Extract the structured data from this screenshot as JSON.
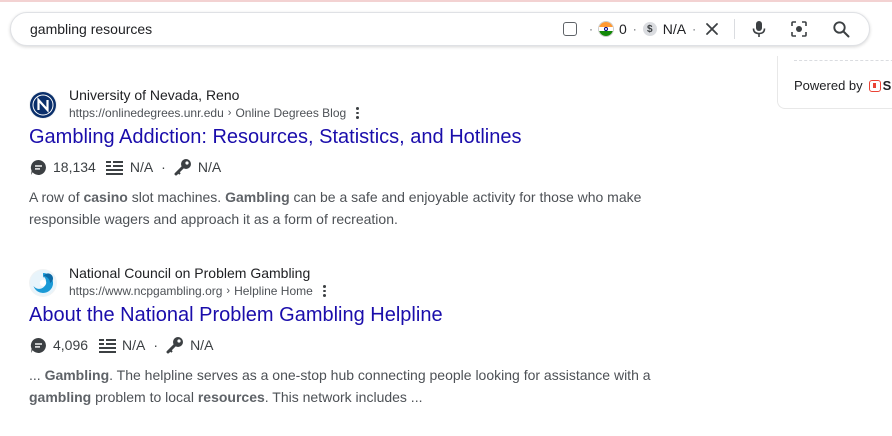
{
  "search": {
    "query": "gambling resources",
    "ext_count": "0",
    "ext_value": "N/A"
  },
  "panel": {
    "powered_by": "Powered by",
    "brand_text": "S"
  },
  "results": [
    {
      "site_name": "University of Nevada, Reno",
      "url": "https://onlinedegrees.unr.edu",
      "breadcrumb": "Online Degrees Blog",
      "title": "Gambling Addiction: Resources, Statistics, and Hotlines",
      "comments": "18,134",
      "list_value": "N/A",
      "key_value": "N/A",
      "snippet": [
        {
          "t": "A row of ",
          "b": false
        },
        {
          "t": "casino",
          "b": true
        },
        {
          "t": " slot machines. ",
          "b": false
        },
        {
          "t": "Gambling",
          "b": true
        },
        {
          "t": " can be a safe and enjoyable activity for those who make responsible wagers and approach it as a form of recreation.",
          "b": false
        }
      ]
    },
    {
      "site_name": "National Council on Problem Gambling",
      "url": "https://www.ncpgambling.org",
      "breadcrumb": "Helpline Home",
      "title": "About the National Problem Gambling Helpline",
      "comments": "4,096",
      "list_value": "N/A",
      "key_value": "N/A",
      "snippet": [
        {
          "t": "... ",
          "b": false
        },
        {
          "t": "Gambling",
          "b": true
        },
        {
          "t": ". The helpline serves as a one-stop hub connecting people looking for assistance with a ",
          "b": false
        },
        {
          "t": "gambling",
          "b": true
        },
        {
          "t": " problem to local ",
          "b": false
        },
        {
          "t": "resources",
          "b": true
        },
        {
          "t": ". This network includes ...",
          "b": false
        }
      ]
    }
  ],
  "icons": {
    "checkbox": "checkbox-icon",
    "flag": "india-flag-icon",
    "dollar": "dollar-icon",
    "close": "close-icon",
    "mic": "microphone-icon",
    "lens": "camera-search-icon",
    "search": "search-icon",
    "comment": "comment-icon",
    "list": "list-icon",
    "key": "key-icon",
    "kebab": "more-vert-icon"
  },
  "colors": {
    "title_link": "#1a0dab",
    "text": "#202124",
    "url": "#4d5156",
    "unr_blue": "#0a2f6b",
    "ncpg_blue": "#1b9ad6"
  }
}
